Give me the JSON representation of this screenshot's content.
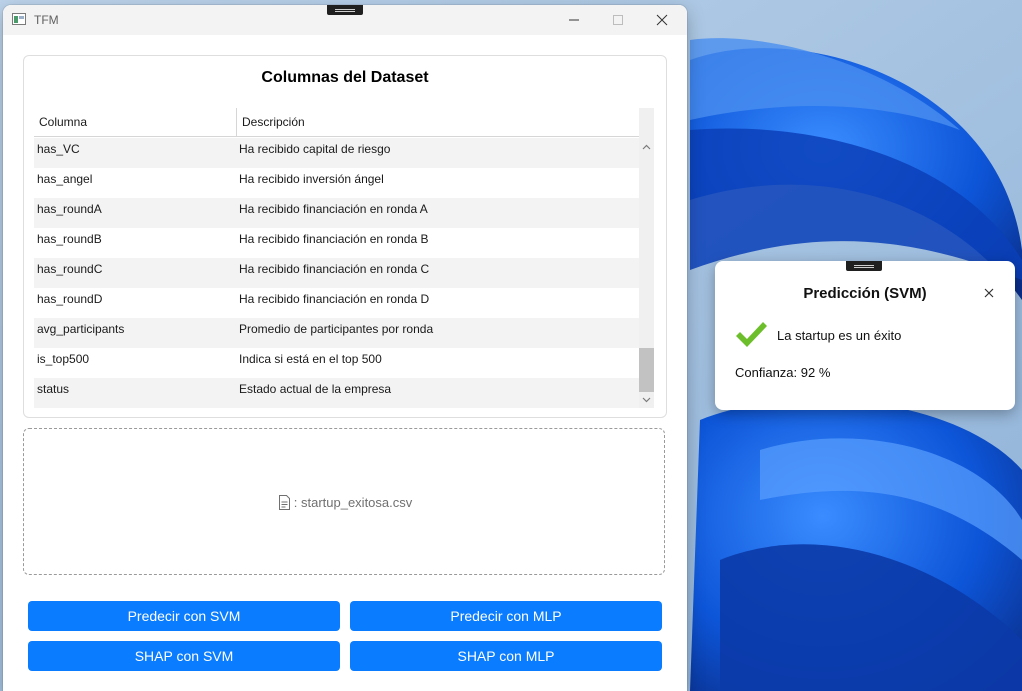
{
  "window": {
    "title": "TFM",
    "minimize_icon": "minimize-icon",
    "maximize_icon": "maximize-icon",
    "close_icon": "close-icon"
  },
  "card": {
    "title": "Columnas del Dataset",
    "columns": [
      "Columna",
      "Descripción"
    ],
    "rows": [
      {
        "column": "has_VC",
        "description": "Ha recibido capital de riesgo"
      },
      {
        "column": "has_angel",
        "description": "Ha recibido inversión ángel"
      },
      {
        "column": "has_roundA",
        "description": "Ha recibido financiación en ronda A"
      },
      {
        "column": "has_roundB",
        "description": "Ha recibido financiación en ronda B"
      },
      {
        "column": "has_roundC",
        "description": "Ha recibido financiación en ronda C"
      },
      {
        "column": "has_roundD",
        "description": "Ha recibido financiación en ronda D"
      },
      {
        "column": "avg_participants",
        "description": "Promedio de participantes por ronda"
      },
      {
        "column": "is_top500",
        "description": "Indica si está en el top 500"
      },
      {
        "column": "status",
        "description": "Estado actual de la empresa"
      }
    ]
  },
  "dropzone": {
    "file_prefix": ": startup_exitosa.csv",
    "file_icon": "document-icon"
  },
  "buttons": {
    "predict_svm": "Predecir con SVM",
    "predict_mlp": "Predecir con MLP",
    "shap_svm": "SHAP con SVM",
    "shap_mlp": "SHAP con MLP"
  },
  "popup": {
    "title": "Predicción (SVM)",
    "result": "La startup es un éxito",
    "confidence": "Confianza: 92 %",
    "check_color": "#6cbf2a"
  },
  "colors": {
    "accent": "#0a7cff",
    "wallpaper": "#1b3f8f"
  }
}
